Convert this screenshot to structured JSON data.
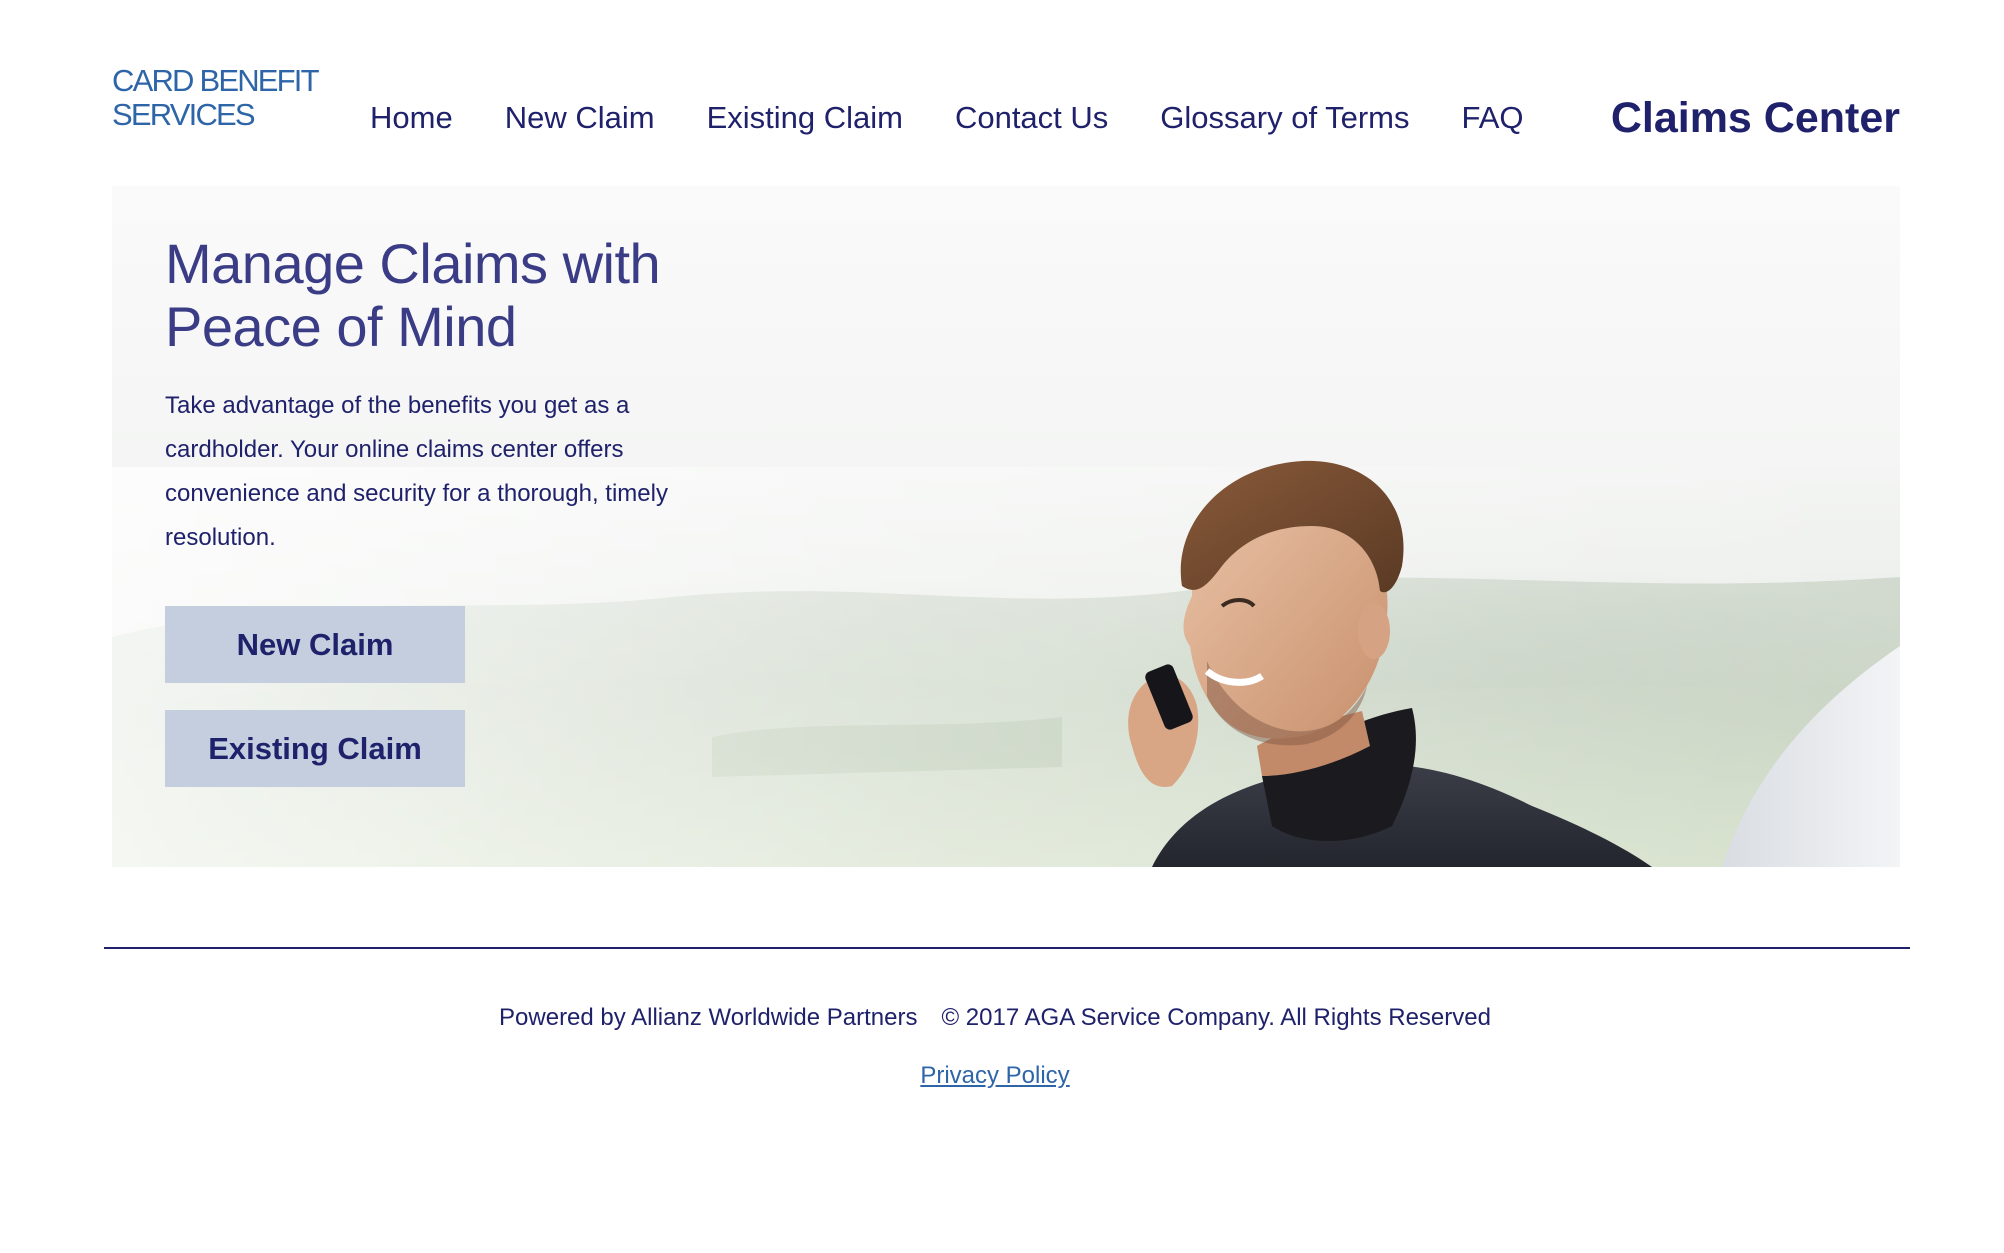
{
  "header": {
    "logo_line1": "CARD BENEFIT",
    "logo_line2": "SERVICES",
    "nav": [
      "Home",
      "New Claim",
      "Existing Claim",
      "Contact Us",
      "Glossary of Terms",
      "FAQ"
    ],
    "brand_title": "Claims Center"
  },
  "hero": {
    "title_line1": "Manage Claims with",
    "title_line2": "Peace of Mind",
    "text": "Take advantage of the benefits you get as a cardholder. Your online claims center offers convenience and security for a thorough, timely resolution.",
    "new_claim_label": "New Claim",
    "existing_claim_label": "Existing Claim"
  },
  "footer": {
    "powered_by": "Powered by Allianz Worldwide Partners",
    "copyright": "© 2017 AGA Service Company. All Rights Reserved",
    "privacy_label": "Privacy Policy"
  },
  "colors": {
    "primary_text": "#1f216b",
    "logo_blue": "#2d65a8",
    "button_bg": "#c5cede",
    "divider": "#1f216b"
  }
}
